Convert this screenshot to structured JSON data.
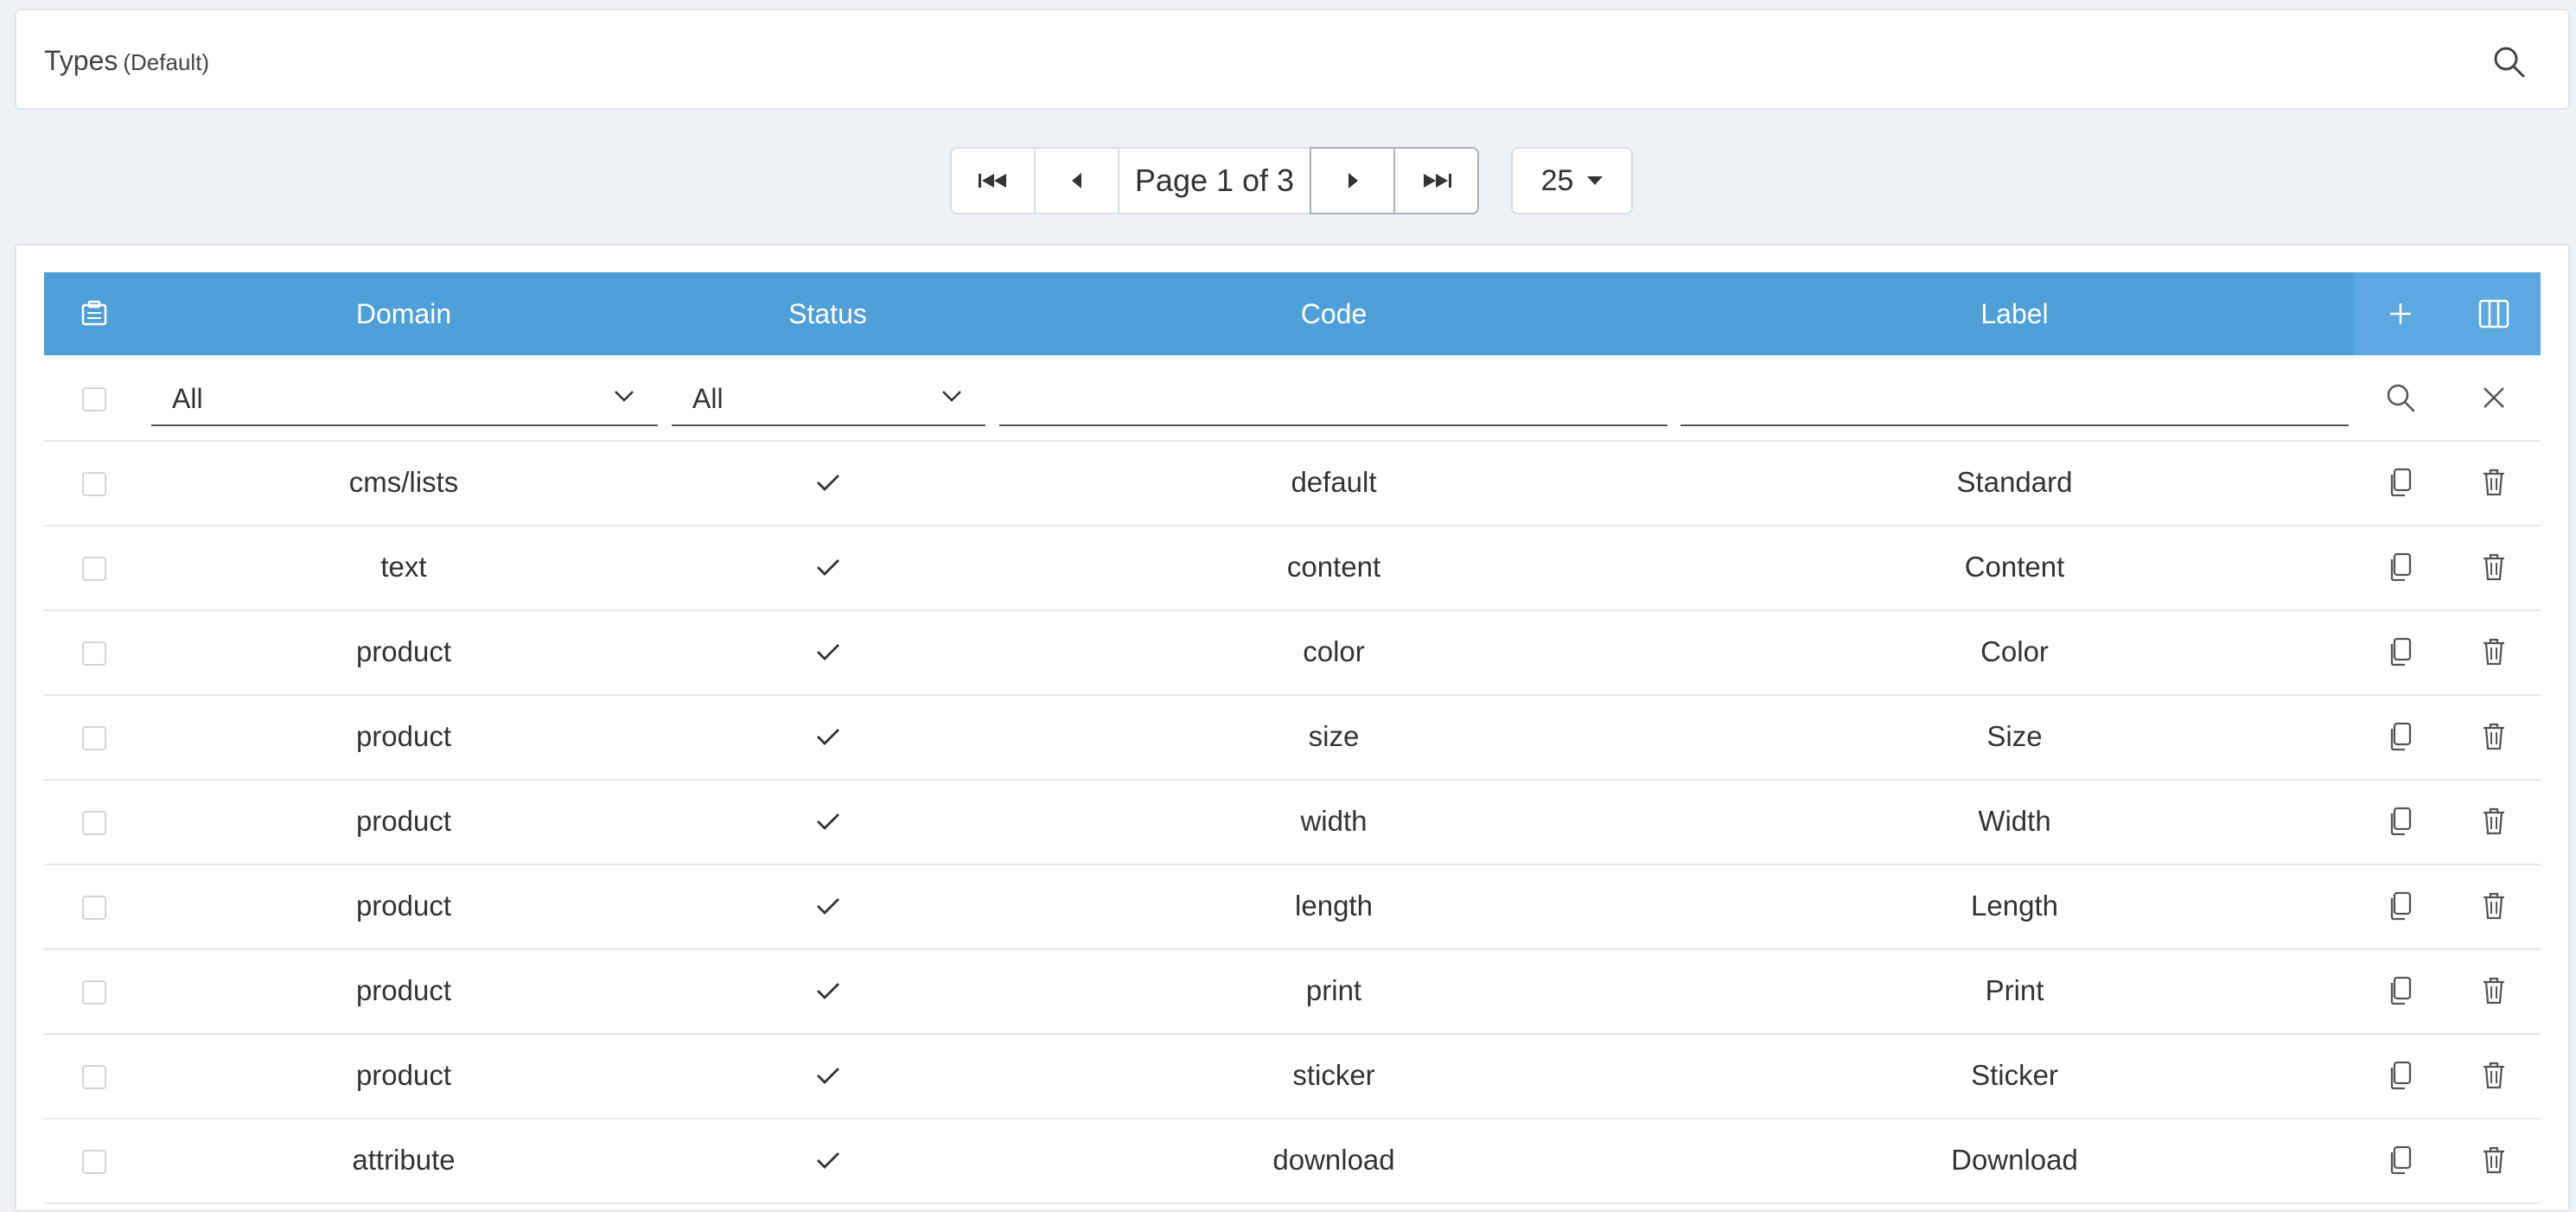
{
  "header": {
    "title": "Types",
    "subtitle": "(Default)"
  },
  "pager": {
    "info": "Page 1 of 3",
    "per_page": "25"
  },
  "table": {
    "columns": [
      "Domain",
      "Status",
      "Code",
      "Label"
    ],
    "filters": {
      "domain": "All",
      "status": "All",
      "code": "",
      "label": ""
    },
    "rows": [
      {
        "domain": "cms/lists",
        "status": "✓",
        "code": "default",
        "label": "Standard"
      },
      {
        "domain": "text",
        "status": "✓",
        "code": "content",
        "label": "Content"
      },
      {
        "domain": "product",
        "status": "✓",
        "code": "color",
        "label": "Color"
      },
      {
        "domain": "product",
        "status": "✓",
        "code": "size",
        "label": "Size"
      },
      {
        "domain": "product",
        "status": "✓",
        "code": "width",
        "label": "Width"
      },
      {
        "domain": "product",
        "status": "✓",
        "code": "length",
        "label": "Length"
      },
      {
        "domain": "product",
        "status": "✓",
        "code": "print",
        "label": "Print"
      },
      {
        "domain": "product",
        "status": "✓",
        "code": "sticker",
        "label": "Sticker"
      },
      {
        "domain": "attribute",
        "status": "✓",
        "code": "download",
        "label": "Download"
      }
    ]
  },
  "colors": {
    "header_bg": "#4f9fd8",
    "header_actions_bg": "#5ba9e0",
    "page_bg": "#eef2f6"
  }
}
